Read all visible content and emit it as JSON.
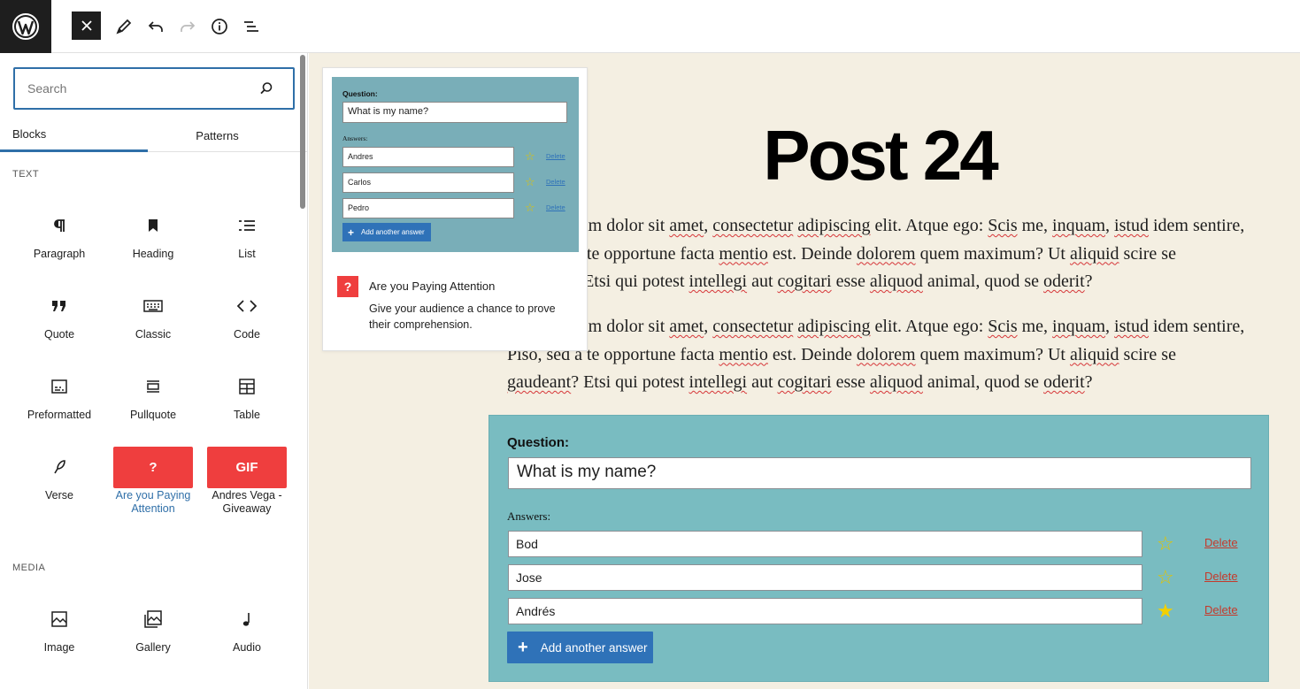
{
  "toolbar": {
    "logo": "wordpress-logo",
    "icons": [
      "close-icon",
      "pencil-icon",
      "undo-icon",
      "redo-icon",
      "info-icon",
      "list-view-icon"
    ]
  },
  "inserter": {
    "search_placeholder": "Search",
    "tabs": {
      "blocks": "Blocks",
      "patterns": "Patterns"
    },
    "categories": {
      "text": "TEXT",
      "media": "MEDIA"
    },
    "text_blocks": [
      {
        "label": "Paragraph",
        "icon": "paragraph-icon"
      },
      {
        "label": "Heading",
        "icon": "heading-icon"
      },
      {
        "label": "List",
        "icon": "list-icon"
      },
      {
        "label": "Quote",
        "icon": "quote-icon"
      },
      {
        "label": "Classic",
        "icon": "keyboard-icon"
      },
      {
        "label": "Code",
        "icon": "code-icon"
      },
      {
        "label": "Preformatted",
        "icon": "preformatted-icon"
      },
      {
        "label": "Pullquote",
        "icon": "pullquote-icon"
      },
      {
        "label": "Table",
        "icon": "table-icon"
      },
      {
        "label": "Verse",
        "icon": "feather-icon"
      },
      {
        "label": "Are you Paying Attention",
        "icon": "question-icon",
        "tile_text": "?"
      },
      {
        "label": "Andres Vega - Giveaway",
        "icon": "gif-icon",
        "tile_text": "GIF"
      }
    ],
    "media_blocks": [
      {
        "label": "Image",
        "icon": "image-icon"
      },
      {
        "label": "Gallery",
        "icon": "gallery-icon"
      },
      {
        "label": "Audio",
        "icon": "audio-icon"
      }
    ]
  },
  "preview": {
    "question_label": "Question:",
    "question_value": "What is my name?",
    "answers_label": "Answers:",
    "answers": [
      "Andres",
      "Carlos",
      "Pedro"
    ],
    "delete_label": "Delete",
    "add_label": "Add another answer",
    "block_icon_text": "?",
    "block_title": "Are you Paying Attention",
    "block_description": "Give your audience a chance to prove their comprehension."
  },
  "post": {
    "title": "Post 24",
    "paragraph": "Lorem ipsum dolor sit amet, consectetur adipiscing elit. Atque ego: Scis me, inquam, istud idem sentire, Piso, sed a te opportune facta mentio est. Deinde dolorem quem maximum? Ut aliquid scire se gaudeant? Etsi qui potest intellegi aut cogitari esse aliquod animal, quod se oderit?"
  },
  "quiz": {
    "question_label": "Question:",
    "question_value": "What is my name?",
    "answers_label": "Answers:",
    "answers": [
      {
        "text": "Bod",
        "correct": false
      },
      {
        "text": "Jose",
        "correct": false
      },
      {
        "text": "Andrés",
        "correct": true
      }
    ],
    "delete_label": "Delete",
    "add_label": "Add another answer"
  },
  "colors": {
    "accent_blue": "#2f72b8",
    "tile_red": "#ef3e3e",
    "quiz_bg": "#79bcc1",
    "canvas_bg": "#f4efe2",
    "star_yellow": "#e2c400",
    "delete_red": "#c5392b"
  }
}
